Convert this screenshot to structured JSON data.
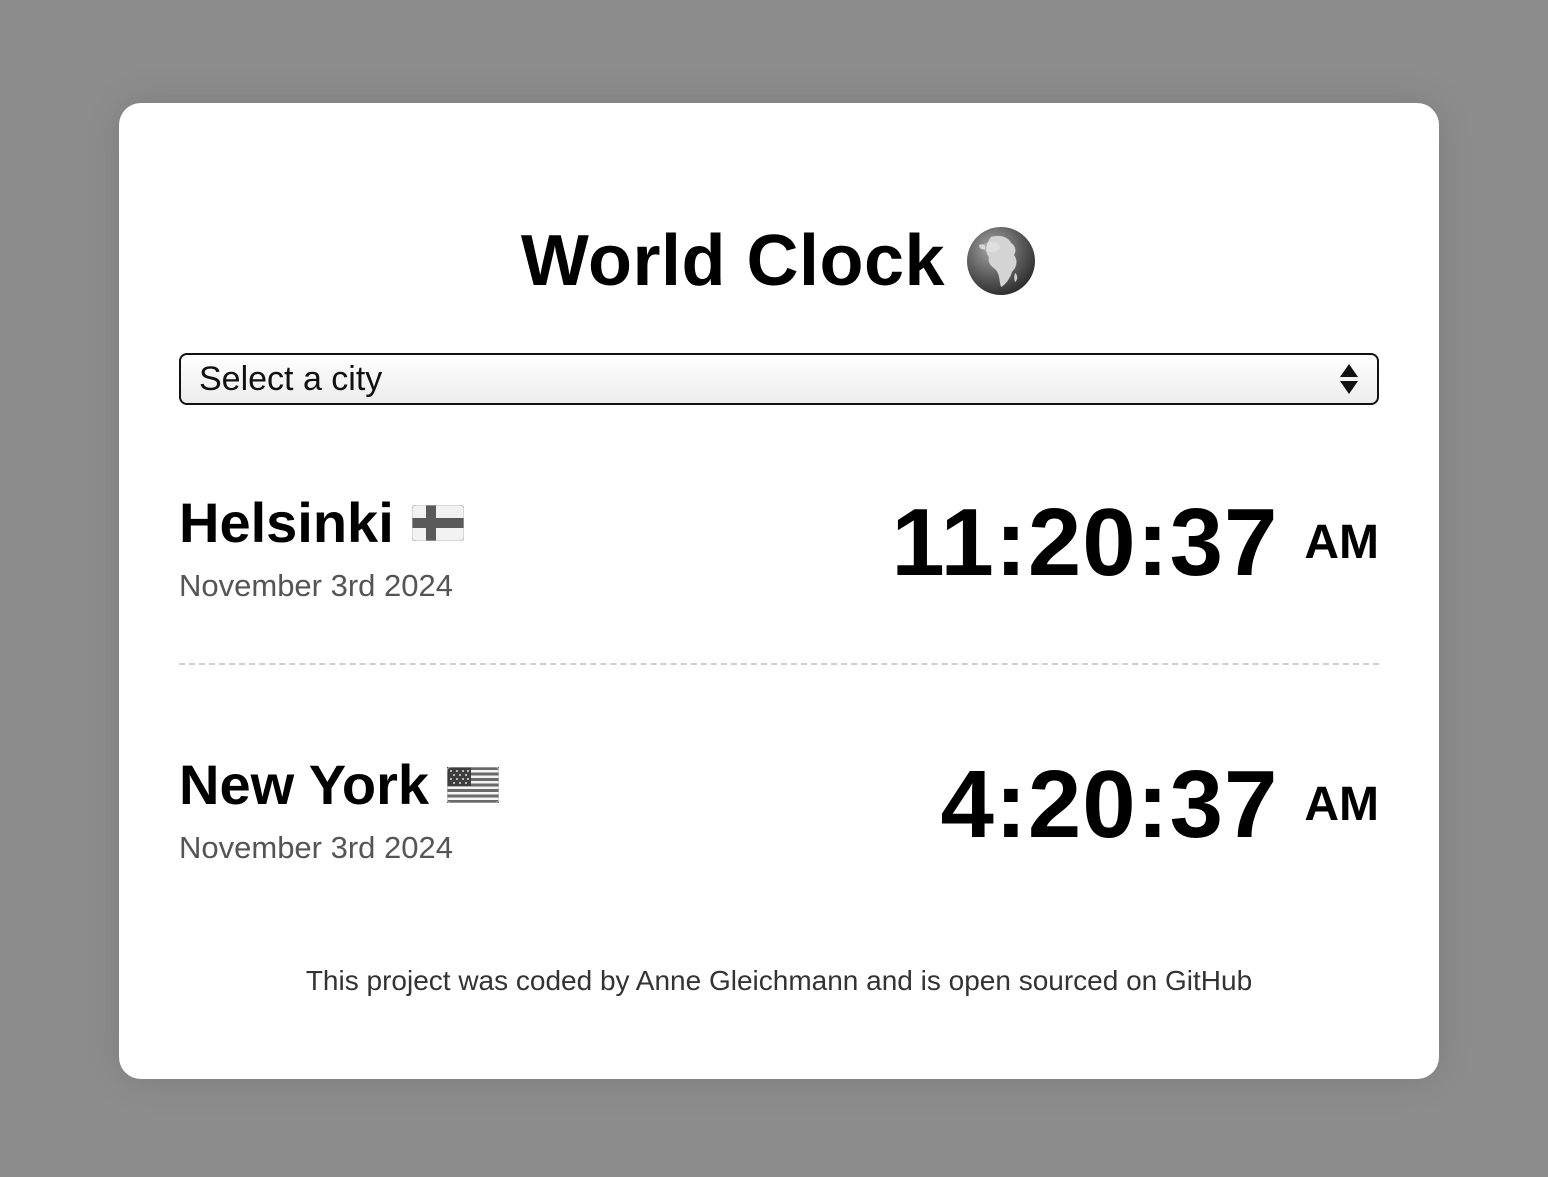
{
  "header": {
    "title": "World Clock",
    "title_icon": "globe-africa-icon"
  },
  "city_select": {
    "selected_label": "Select a city"
  },
  "cities": [
    {
      "name": "Helsinki",
      "flag": "finland-flag-icon",
      "date": "November 3rd 2024",
      "time": "11:20:37",
      "ampm": "AM"
    },
    {
      "name": "New York",
      "flag": "usa-flag-icon",
      "date": "November 3rd 2024",
      "time": "4:20:37",
      "ampm": "AM"
    }
  ],
  "footer": {
    "text_1": "This project was coded by ",
    "author": "Anne Gleichmann",
    "text_2": " and is ",
    "open_source_link": "open sourced on GitHub"
  },
  "colors": {
    "page_background": "#8d8d8d",
    "card_background": "#ffffff",
    "date_text": "#555555",
    "divider": "#cfcfcf"
  }
}
